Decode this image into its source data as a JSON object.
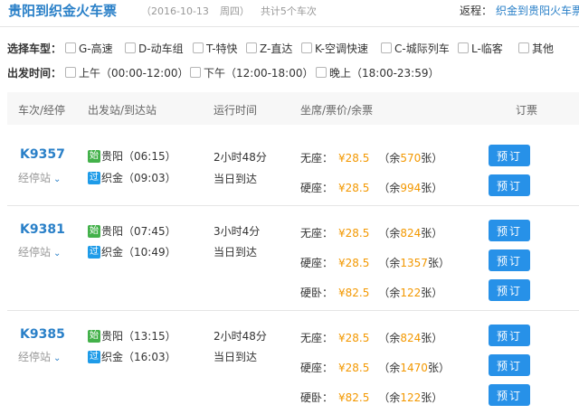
{
  "header": {
    "title": "贵阳到织金火车票",
    "date": "（2016-10-13",
    "weekday": "周四）",
    "count": "共计5个车次",
    "return_label": "返程：",
    "return_link": "织金到贵阳火车票"
  },
  "filters": {
    "type_label": "选择车型：",
    "types": [
      "G-高速",
      "D-动车组",
      "T-特快",
      "Z-直达",
      "K-空调快速",
      "C-城际列车",
      "L-临客",
      "其他"
    ],
    "time_label": "出发时间：",
    "times": [
      "上午（00:00-12:00）",
      "下午（12:00-18:00）",
      "晚上（18:00-23:59）"
    ]
  },
  "table_header": {
    "train": "车次/经停",
    "stations": "出发站/到达站",
    "duration": "运行时间",
    "seats": "坐席/票价/余票",
    "book": "订票"
  },
  "trains": [
    {
      "number": "K9357",
      "stops_label": "经停站",
      "depart_badge": "始",
      "depart": "贵阳（06:15）",
      "arrive_badge": "过",
      "arrive": "织金（09:03）",
      "duration": "2小时48分",
      "arrival_day": "当日到达",
      "seats": [
        {
          "type": "无座：",
          "price": "¥28.5",
          "rem_prefix": "（余",
          "count": "570",
          "rem_suffix": "张）",
          "button": "预订"
        },
        {
          "type": "硬座：",
          "price": "¥28.5",
          "rem_prefix": "（余",
          "count": "994",
          "rem_suffix": "张）",
          "button": "预订"
        }
      ]
    },
    {
      "number": "K9381",
      "stops_label": "经停站",
      "depart_badge": "始",
      "depart": "贵阳（07:45）",
      "arrive_badge": "过",
      "arrive": "织金（10:49）",
      "duration": "3小时4分",
      "arrival_day": "当日到达",
      "seats": [
        {
          "type": "无座：",
          "price": "¥28.5",
          "rem_prefix": "（余",
          "count": "824",
          "rem_suffix": "张）",
          "button": "预订"
        },
        {
          "type": "硬座：",
          "price": "¥28.5",
          "rem_prefix": "（余",
          "count": "1357",
          "rem_suffix": "张）",
          "button": "预订"
        },
        {
          "type": "硬卧：",
          "price": "¥82.5",
          "rem_prefix": "（余",
          "count": "122",
          "rem_suffix": "张）",
          "button": "预订"
        }
      ]
    },
    {
      "number": "K9385",
      "stops_label": "经停站",
      "depart_badge": "始",
      "depart": "贵阳（13:15）",
      "arrive_badge": "过",
      "arrive": "织金（16:03）",
      "duration": "2小时48分",
      "arrival_day": "当日到达",
      "seats": [
        {
          "type": "无座：",
          "price": "¥28.5",
          "rem_prefix": "（余",
          "count": "824",
          "rem_suffix": "张）",
          "button": "预订"
        },
        {
          "type": "硬座：",
          "price": "¥28.5",
          "rem_prefix": "（余",
          "count": "1470",
          "rem_suffix": "张）",
          "button": "预订"
        },
        {
          "type": "硬卧：",
          "price": "¥82.5",
          "rem_prefix": "（余",
          "count": "122",
          "rem_suffix": "张）",
          "button": "预订"
        }
      ]
    }
  ]
}
